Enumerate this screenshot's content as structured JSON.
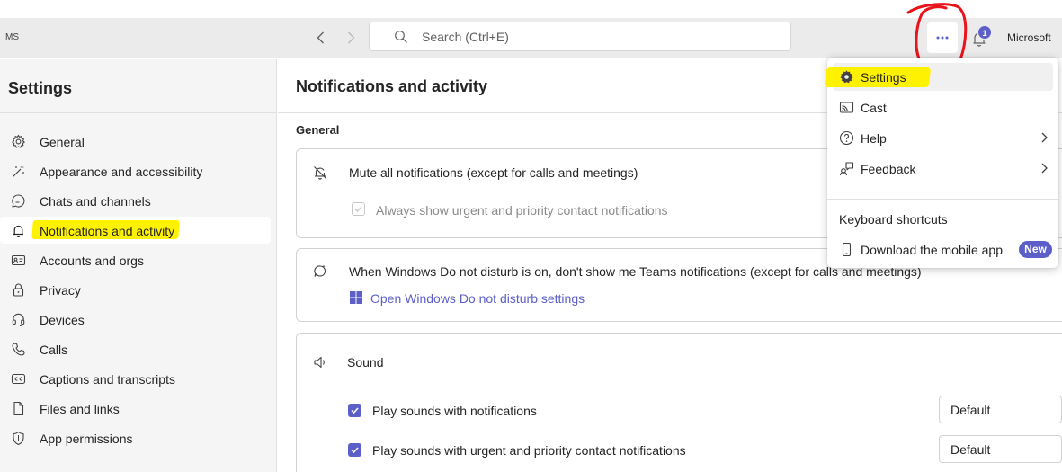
{
  "titlebar": {
    "initials": "MS",
    "search_placeholder": "Search (Ctrl+E)",
    "notification_count": "1",
    "tenant_name": "Microsoft"
  },
  "sidebar": {
    "title": "Settings",
    "items": [
      {
        "label": "General",
        "icon": "gear-icon"
      },
      {
        "label": "Appearance and accessibility",
        "icon": "wand-icon"
      },
      {
        "label": "Chats and channels",
        "icon": "chat-icon"
      },
      {
        "label": "Notifications and activity",
        "icon": "bell-icon",
        "active": true
      },
      {
        "label": "Accounts and orgs",
        "icon": "contact-card-icon"
      },
      {
        "label": "Privacy",
        "icon": "lock-icon"
      },
      {
        "label": "Devices",
        "icon": "headset-icon"
      },
      {
        "label": "Calls",
        "icon": "phone-icon"
      },
      {
        "label": "Captions and transcripts",
        "icon": "cc-icon"
      },
      {
        "label": "Files and links",
        "icon": "document-icon"
      },
      {
        "label": "App permissions",
        "icon": "shield-icon"
      }
    ]
  },
  "main": {
    "title": "Notifications and activity",
    "section_general": "General",
    "mute": {
      "label": "Mute all notifications (except for calls and meetings)",
      "urgent_label": "Always show urgent and priority contact notifications"
    },
    "dnd": {
      "label": "When Windows Do not disturb is on, don't show me Teams notifications (except for calls and meetings)",
      "link": "Open Windows Do not disturb settings"
    },
    "sound": {
      "title": "Sound",
      "play_sounds_label": "Play sounds with notifications",
      "play_sounds_value": "Default",
      "urgent_sounds_label": "Play sounds with urgent and priority contact notifications",
      "urgent_sounds_value": "Default"
    }
  },
  "menu": {
    "items": [
      {
        "label": "Settings",
        "icon": "gear-icon"
      },
      {
        "label": "Cast",
        "icon": "cast-icon"
      },
      {
        "label": "Help",
        "icon": "question-icon"
      },
      {
        "label": "Feedback",
        "icon": "feedback-icon"
      }
    ],
    "keyboard_shortcuts": "Keyboard shortcuts",
    "download_app": "Download the mobile app",
    "new_badge": "New"
  },
  "colors": {
    "accent": "#5b5fc7",
    "highlight": "#fff200",
    "annotation": "#e8141b"
  }
}
